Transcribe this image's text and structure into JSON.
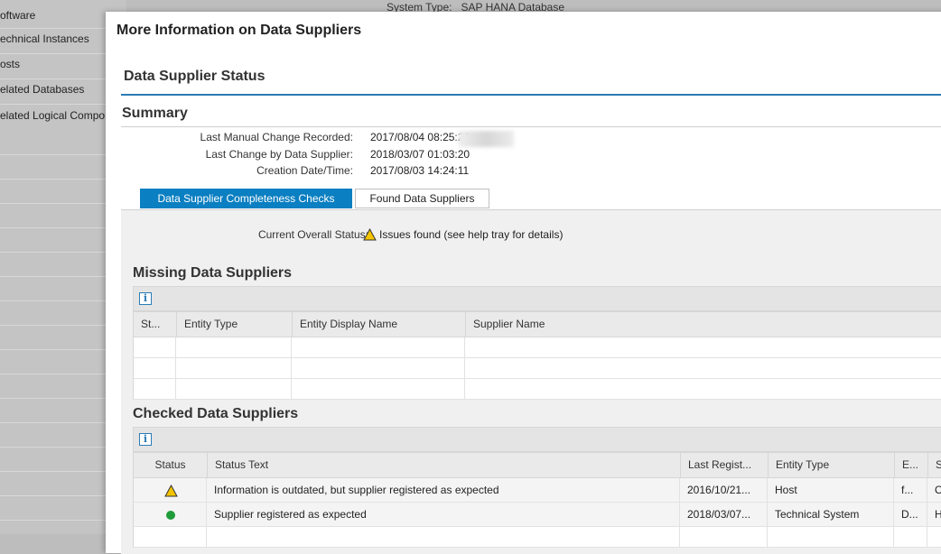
{
  "background": {
    "system_type_label": "System Type:",
    "system_type_value": "SAP HANA Database",
    "sidebar_items": [
      "oftware",
      "echnical Instances",
      "osts",
      "elated Databases",
      "elated Logical Compon os"
    ]
  },
  "dialog": {
    "title": "More Information on Data Suppliers",
    "section_title": "Data Supplier Status",
    "summary_title": "Summary",
    "summary": [
      {
        "label": "Last Manual Change Recorded:",
        "value": "2017/08/04 08:25:20"
      },
      {
        "label": "Last Change by Data Supplier:",
        "value": "2018/03/07 01:03:20"
      },
      {
        "label": "Creation Date/Time:",
        "value": "2017/08/03 14:24:11"
      }
    ],
    "tabs": [
      {
        "label": "Data Supplier Completeness Checks",
        "active": true
      },
      {
        "label": "Found Data Suppliers",
        "active": false
      }
    ],
    "overall_status": {
      "label": "Current Overall Status:",
      "value": "Issues found (see help tray for details)"
    },
    "missing": {
      "title": "Missing Data Suppliers",
      "columns": [
        "St...",
        "Entity Type",
        "Entity Display Name",
        "Supplier Name"
      ]
    },
    "checked": {
      "title": "Checked Data Suppliers",
      "columns": [
        "Status",
        "Status Text",
        "Last Regist...",
        "Entity Type",
        "E...",
        "S"
      ],
      "rows": [
        {
          "status": "warning",
          "status_text": "Information is outdated, but supplier registered as expected",
          "last_regist": "2016/10/21...",
          "entity_type": "Host",
          "e": "f...",
          "s": "O"
        },
        {
          "status": "ok",
          "status_text": "Supplier registered as expected",
          "last_regist": "2018/03/07...",
          "entity_type": "Technical System",
          "e": "D...",
          "s": "H"
        }
      ]
    }
  },
  "colors": {
    "accent": "#0a7fc1",
    "warning": "#f5c400",
    "ok": "#1f9b3a"
  },
  "icons": [
    "warning-icon",
    "info-icon",
    "status-ok-icon"
  ]
}
